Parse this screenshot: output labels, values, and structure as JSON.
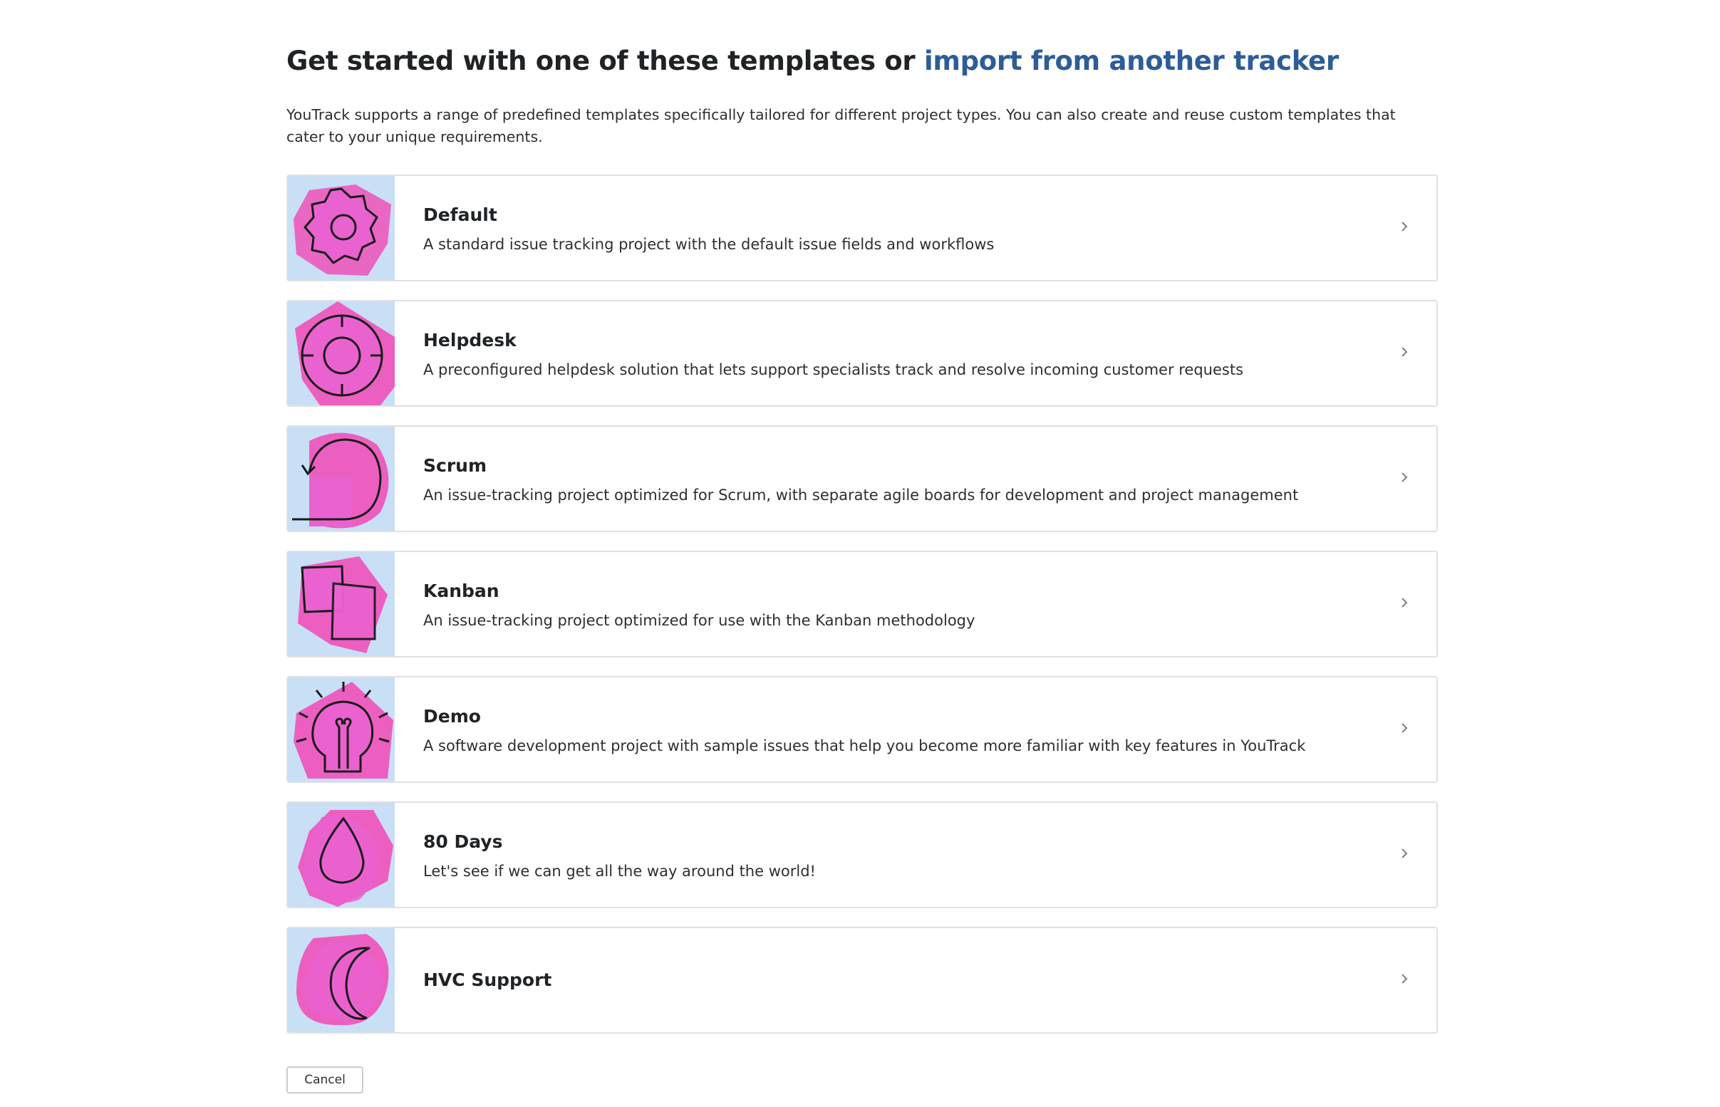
{
  "header": {
    "title_prefix": "Get started with one of these templates or ",
    "import_link": "import from another tracker"
  },
  "intro": "YouTrack supports a range of predefined templates specifically tailored for different project types. You can also create and reuse custom templates that cater to your unique requirements.",
  "templates": [
    {
      "title": "Default",
      "description": "A standard issue tracking project with the default issue fields and workflows",
      "icon": "gear-icon"
    },
    {
      "title": "Helpdesk",
      "description": "A preconfigured helpdesk solution that lets support specialists track and resolve incoming customer requests",
      "icon": "lifebuoy-icon"
    },
    {
      "title": "Scrum",
      "description": "An issue-tracking project optimized for Scrum, with separate agile boards for development and project management",
      "icon": "loop-arrow-icon"
    },
    {
      "title": "Kanban",
      "description": "An issue-tracking project optimized for use with the Kanban methodology",
      "icon": "cards-icon"
    },
    {
      "title": "Demo",
      "description": "A software development project with sample issues that help you become more familiar with key features in YouTrack",
      "icon": "lightbulb-icon"
    },
    {
      "title": "80 Days",
      "description": "Let's see if we can get all the way around the world!",
      "icon": "drop-icon"
    },
    {
      "title": "HVC Support",
      "description": "",
      "icon": "moon-icon"
    }
  ],
  "footer": {
    "cancel_label": "Cancel"
  },
  "colors": {
    "accent": "#2d5d97",
    "thumb_bg": "#c9dff6",
    "blob": "#ec5fc0"
  }
}
